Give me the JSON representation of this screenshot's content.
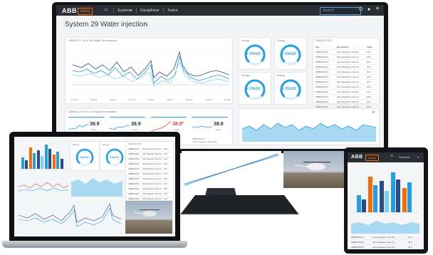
{
  "monitor": {
    "topbar": {
      "logo": "ABB",
      "badge": "Ability",
      "menu_items": [
        "Systems",
        "Disciplines",
        "Tools"
      ],
      "search_placeholder": "Search"
    },
    "page_title": "System 29 Water injection",
    "chart1": {
      "title": "20BM0172 1 Ist & 2nd Stage Recompressor",
      "x_labels": [
        "14 Nov",
        "15 Nov",
        "16 Nov",
        "17 Nov",
        "18 Nov",
        "19 Nov",
        "20 Nov",
        "21 Nov",
        "22 Nov"
      ]
    },
    "gauges": [
      {
        "label": "Energy",
        "value": "+ 154.62"
      },
      {
        "label": "Energy",
        "value": "+ 154.62"
      },
      {
        "label": "Energy",
        "value": "+ 154.62"
      },
      {
        "label": "Energy",
        "value": "+ 154.62"
      }
    ],
    "table": {
      "title": "20BM0172021",
      "headers": [
        "Tag",
        "Description",
        "Value"
      ],
      "rows": [
        [
          "20BE0322/11",
          "Inlet Separator Gas Ou...",
          "26.6"
        ],
        [
          "20BE0322/11",
          "Inlet Separator Gas Ou...",
          "26.6"
        ],
        [
          "20BE0322/11",
          "Inlet Separator Gas Ou...",
          "26.6"
        ],
        [
          "20BE0322/11",
          "Inlet Separator Gas Ou...",
          "26.6"
        ],
        [
          "20BE0322/11",
          "Inlet Separator Gas Ou...",
          "26.6"
        ],
        [
          "20BE0322/11",
          "Inlet Separator Gas Ou...",
          "26.6"
        ],
        [
          "20BE0322/11",
          "Inlet Separator Gas Ou...",
          "26.6"
        ],
        [
          "20BE0322/11",
          "Inlet Separator Gas Ou...",
          "26.6"
        ],
        [
          "20BE0322/11",
          "Inlet Separator Gas Ou...",
          "26.6"
        ],
        [
          "20BE0322/11",
          "Inlet Separator Gas Ou...",
          "26.6"
        ],
        [
          "20BE0322/11",
          "Inlet Separator Gas Ou...",
          "26.6"
        ],
        [
          "20BE0322/11",
          "Inlet Separator Gas Ou...",
          "26.6"
        ]
      ]
    },
    "kpi_panel": {
      "title": "20BM0172 1 Ist & 2nd Stage Recompressor",
      "kpis": [
        {
          "value": "38.9",
          "unit": "bar(g)",
          "color": "#2b2f36"
        },
        {
          "value": "38.9",
          "unit": "bar(g)",
          "color": "#2b2f36"
        },
        {
          "value": "38.9°",
          "unit": "bar(g)",
          "color": "#e04a43"
        },
        {
          "value": "38.9",
          "unit": "bar(g)",
          "color": "#2b2f36"
        }
      ],
      "subcaption_tag": "20BE0322/11",
      "subcaption_desc": "Inlet Separator Gas Outlet"
    }
  },
  "laptop": {
    "table_title": "20BM0172021",
    "gauges": [
      {
        "label": "Energy",
        "value": "+ 154.62"
      },
      {
        "label": "Energy",
        "value": "+ 154.62"
      }
    ]
  },
  "tablet": {
    "topbar": {
      "logo": "ABB",
      "badge": "Ability",
      "menu": "Systems"
    },
    "rows": [
      [
        "20BE0322/11",
        "Inlet Separator Gas Ou...",
        "26.6"
      ],
      [
        "20BE0322/11",
        "Inlet Separator Gas Ou...",
        "26.6"
      ],
      [
        "20BE0322/11",
        "Inlet Separator Gas Ou...",
        "26.6"
      ]
    ]
  },
  "colors": {
    "accent": "#1fa0e6",
    "brand": "#ff6a00",
    "dark_blue": "#2b4a8c"
  }
}
